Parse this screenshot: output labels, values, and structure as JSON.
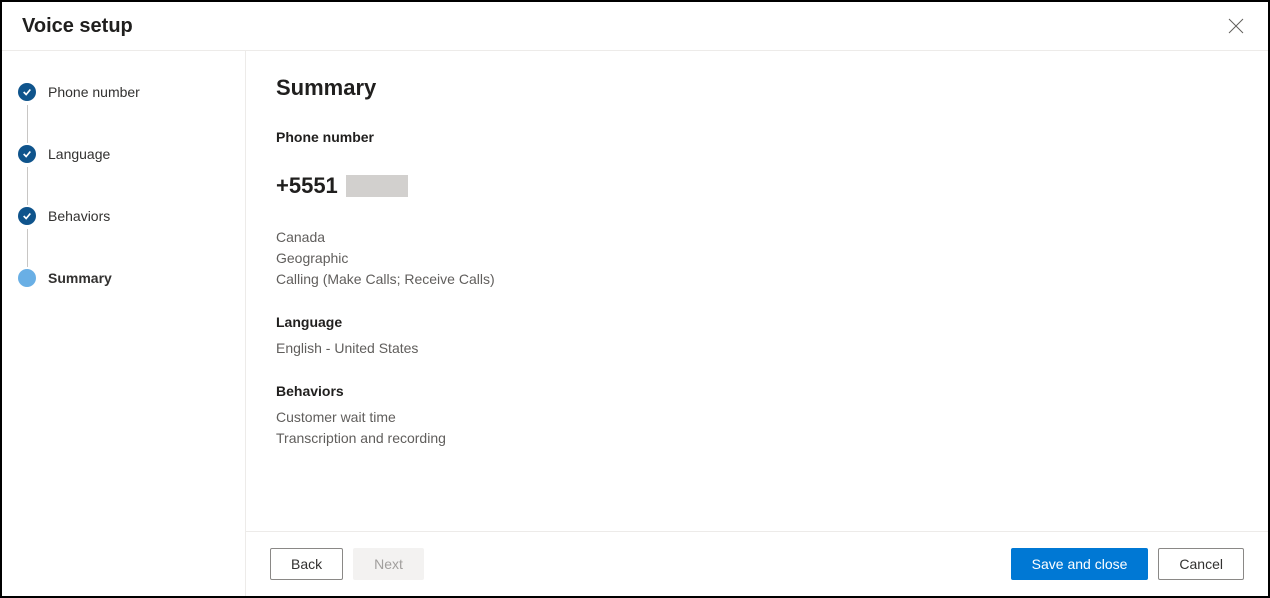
{
  "header": {
    "title": "Voice setup"
  },
  "sidebar": {
    "steps": [
      {
        "label": "Phone number",
        "state": "completed"
      },
      {
        "label": "Language",
        "state": "completed"
      },
      {
        "label": "Behaviors",
        "state": "completed"
      },
      {
        "label": "Summary",
        "state": "current"
      }
    ]
  },
  "content": {
    "title": "Summary",
    "phone_section": {
      "label": "Phone number",
      "number_prefix": "+5551",
      "country": "Canada",
      "type": "Geographic",
      "capabilities": "Calling (Make Calls; Receive Calls)"
    },
    "language_section": {
      "label": "Language",
      "value": "English - United States"
    },
    "behaviors_section": {
      "label": "Behaviors",
      "items": [
        "Customer wait time",
        "Transcription and recording"
      ]
    }
  },
  "footer": {
    "back": "Back",
    "next": "Next",
    "save": "Save and close",
    "cancel": "Cancel"
  }
}
